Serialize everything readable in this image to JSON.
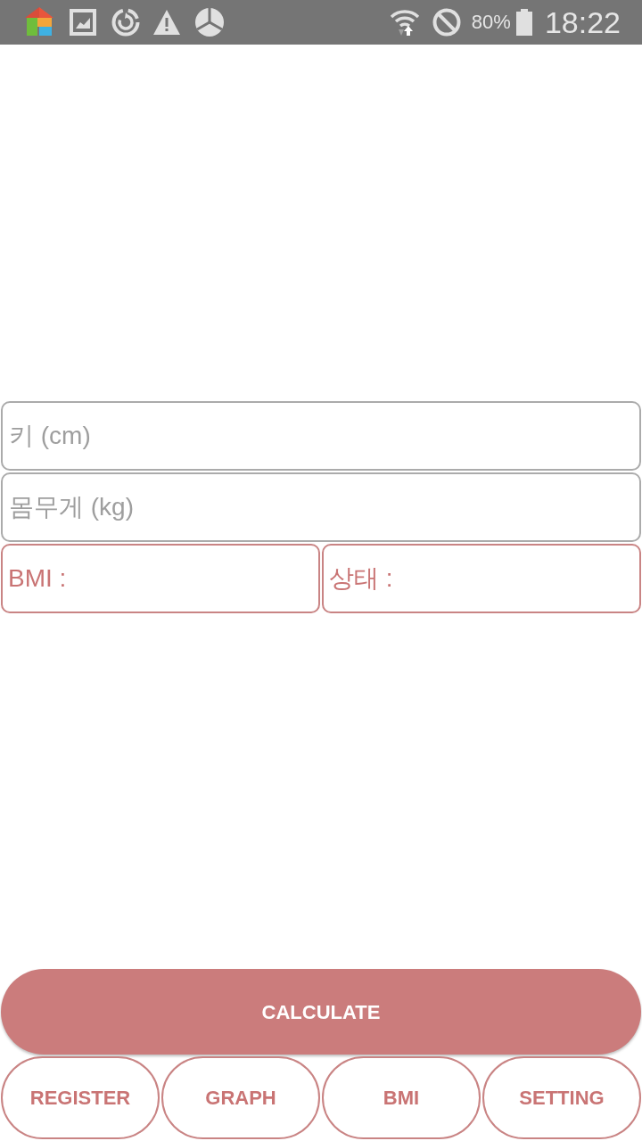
{
  "status_bar": {
    "battery": "80%",
    "time": "18:22"
  },
  "form": {
    "fields": [
      {
        "placeholder": "키 (cm)"
      },
      {
        "placeholder": "몸무게 (kg)"
      }
    ],
    "results": [
      {
        "label": "BMI :"
      },
      {
        "label": "상태 :"
      }
    ]
  },
  "calculate_button": {
    "label": "CALCULATE"
  },
  "nav_buttons": [
    {
      "label": "REGISTER"
    },
    {
      "label": "GRAPH"
    },
    {
      "label": "BMI"
    },
    {
      "label": "SETTING"
    }
  ]
}
